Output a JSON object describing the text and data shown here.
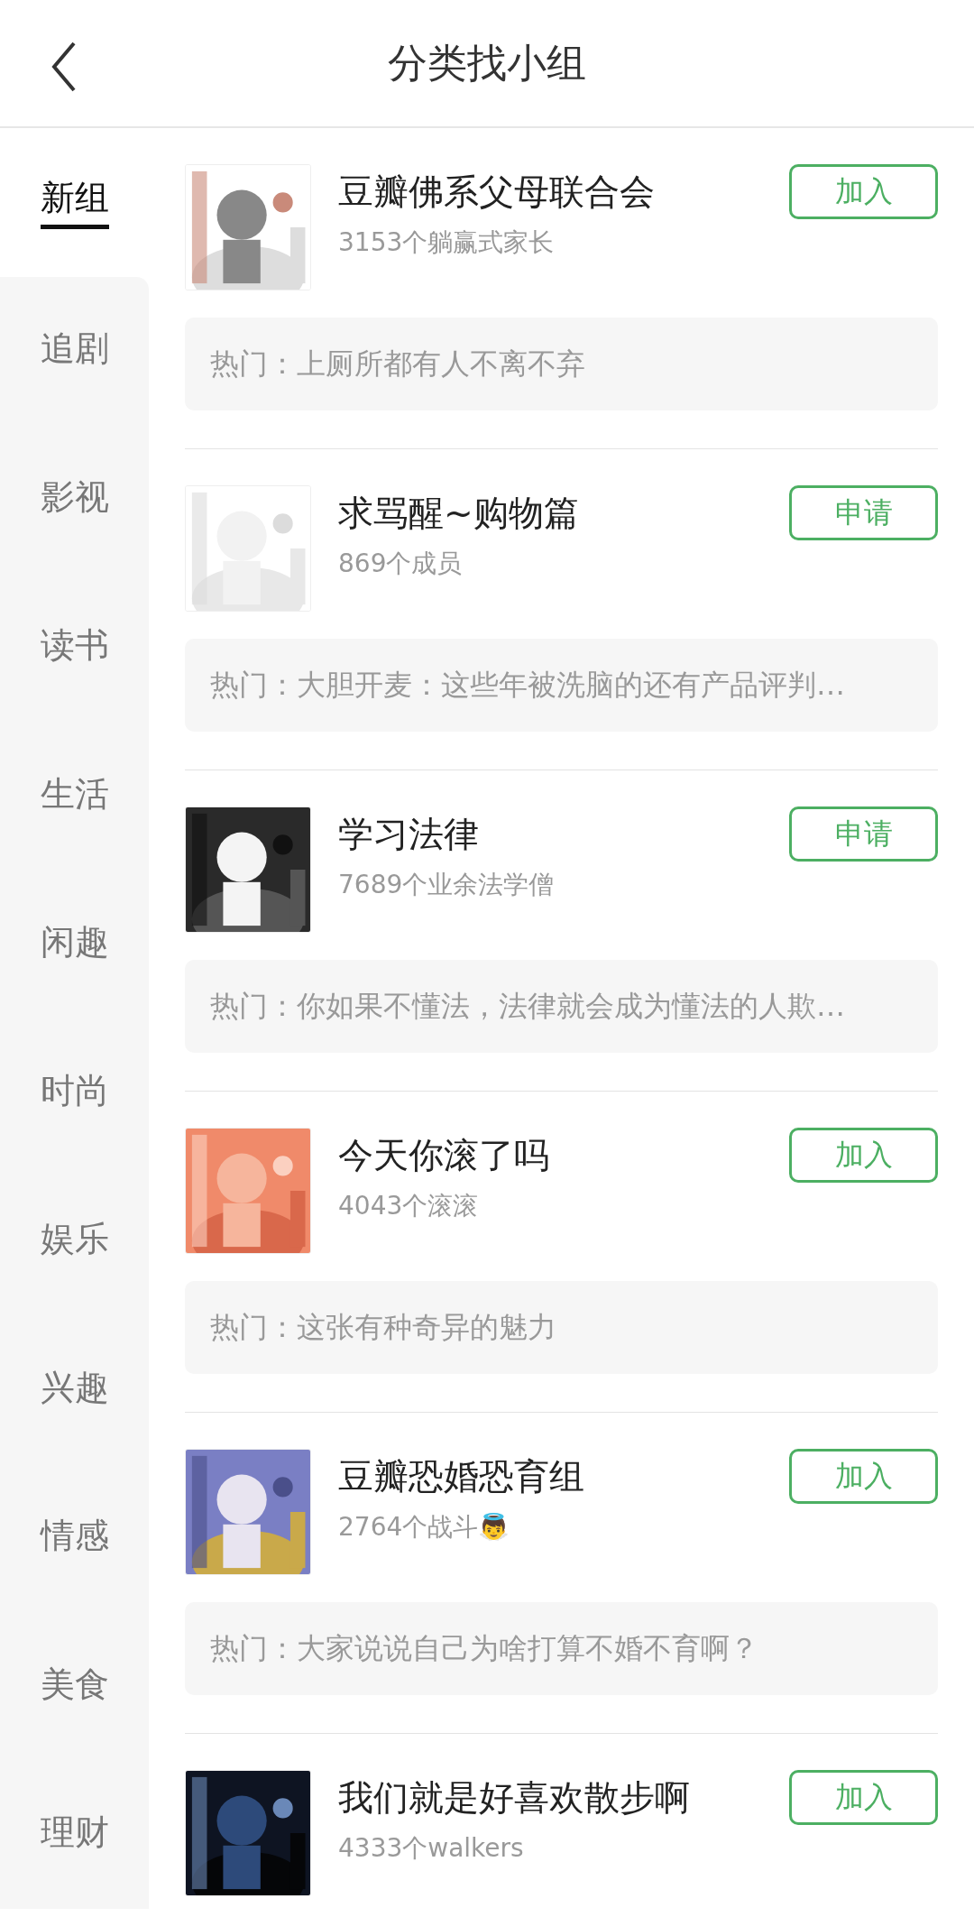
{
  "header": {
    "title": "分类找小组"
  },
  "sidebar": {
    "items": [
      {
        "label": "新组",
        "selected": true
      },
      {
        "label": "追剧",
        "selected": false
      },
      {
        "label": "影视",
        "selected": false
      },
      {
        "label": "读书",
        "selected": false
      },
      {
        "label": "生活",
        "selected": false
      },
      {
        "label": "闲趣",
        "selected": false
      },
      {
        "label": "时尚",
        "selected": false
      },
      {
        "label": "娱乐",
        "selected": false
      },
      {
        "label": "兴趣",
        "selected": false
      },
      {
        "label": "情感",
        "selected": false
      },
      {
        "label": "美食",
        "selected": false
      },
      {
        "label": "理财",
        "selected": false
      }
    ]
  },
  "groups": [
    {
      "name": "豆瓣佛系父母联合会",
      "members": "3153个躺赢式家长",
      "button": "加入",
      "hot": "热门：上厕所都有人不离不弃"
    },
    {
      "name": "求骂醒~购物篇",
      "members": "869个成员",
      "button": "申请",
      "hot": "热门：大胆开麦：这些年被洗脑的还有产品评判…"
    },
    {
      "name": "学习法律",
      "members": "7689个业余法学僧",
      "button": "申请",
      "hot": "热门：你如果不懂法，法律就会成为懂法的人欺…"
    },
    {
      "name": "今天你滚了吗",
      "members": "4043个滚滚",
      "button": "加入",
      "hot": "热门：这张有种奇异的魅力"
    },
    {
      "name": "豆瓣恐婚恐育组",
      "members": "2764个战斗👼",
      "button": "加入",
      "hot": "热门：大家说说自己为啥打算不婚不育啊？"
    },
    {
      "name": "我们就是好喜欢散步啊",
      "members": "4333个walkers",
      "button": "加入"
    }
  ]
}
